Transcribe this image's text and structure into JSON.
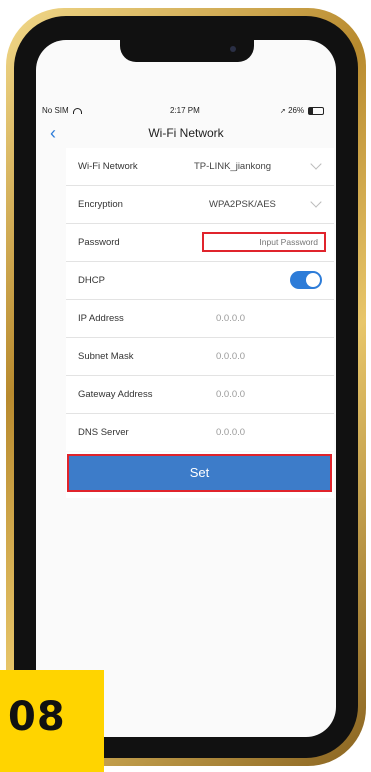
{
  "status_bar": {
    "carrier": "No SIM",
    "time": "2:17 PM",
    "battery": "26%"
  },
  "nav": {
    "title": "Wi-Fi Network",
    "back_icon": "chevron-left-icon"
  },
  "rows": [
    {
      "label": "Wi-Fi Network",
      "value": "TP-LINK_jiankong"
    },
    {
      "label": "Encryption",
      "value": "WPA2PSK/AES"
    },
    {
      "label": "Password",
      "placeholder": "Input Password"
    },
    {
      "label": "DHCP",
      "toggle_on": true
    },
    {
      "label": "IP Address",
      "value": "0.0.0.0"
    },
    {
      "label": "Subnet Mask",
      "value": "0.0.0.0"
    },
    {
      "label": "Gateway Address",
      "value": "0.0.0.0"
    },
    {
      "label": "DNS Server",
      "value": "0.0.0.0"
    }
  ],
  "set_button": {
    "label": "Set"
  },
  "step_badge": {
    "text": "08"
  },
  "colors": {
    "accent": "#3d7cc9",
    "highlight": "#e0242c",
    "badge": "#ffd400",
    "frame_gold": "#c9a04a"
  }
}
